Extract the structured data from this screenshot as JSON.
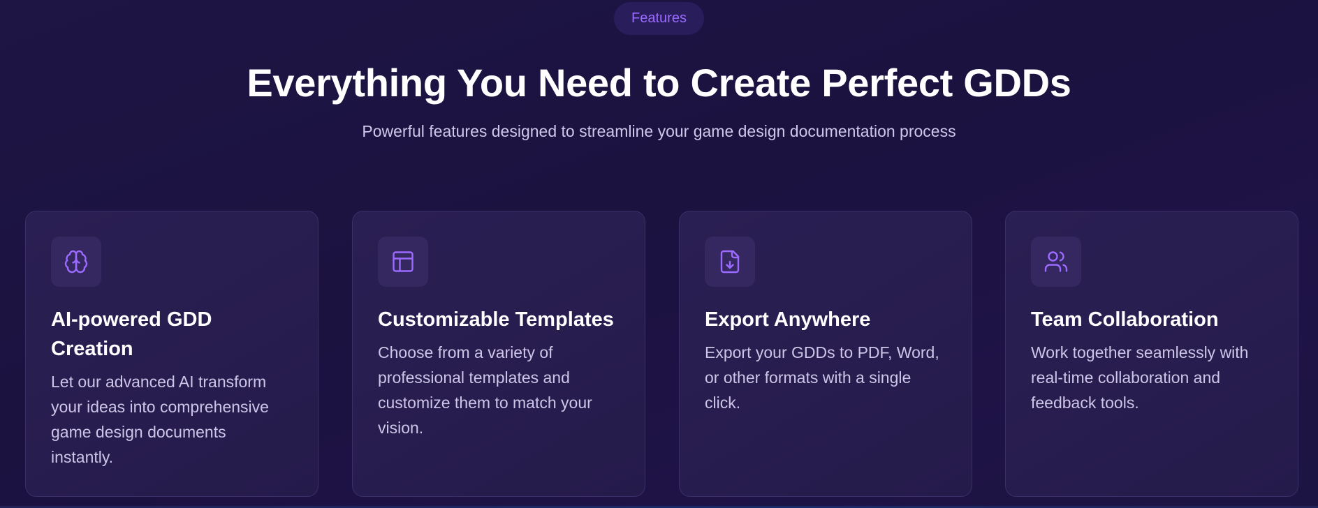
{
  "colors": {
    "background": "#1d1443",
    "accent": "#9b6bff",
    "badge_bg": "#2a1d5c",
    "card_bg": "#281d4f",
    "icon_bg": "#35275f"
  },
  "header": {
    "badge": "Features",
    "title": "Everything You Need to Create Perfect GDDs",
    "subtitle": "Powerful features designed to streamline your game design documentation process"
  },
  "features": [
    {
      "icon": "brain-icon",
      "title": "AI-powered GDD Creation",
      "description": "Let our advanced AI transform your ideas into comprehensive game design documents instantly."
    },
    {
      "icon": "layout-template-icon",
      "title": "Customizable Templates",
      "description": "Choose from a variety of professional templates and customize them to match your vision."
    },
    {
      "icon": "file-download-icon",
      "title": "Export Anywhere",
      "description": "Export your GDDs to PDF, Word, or other formats with a single click."
    },
    {
      "icon": "users-icon",
      "title": "Team Collaboration",
      "description": "Work together seamlessly with real-time collaboration and feedback tools."
    }
  ]
}
